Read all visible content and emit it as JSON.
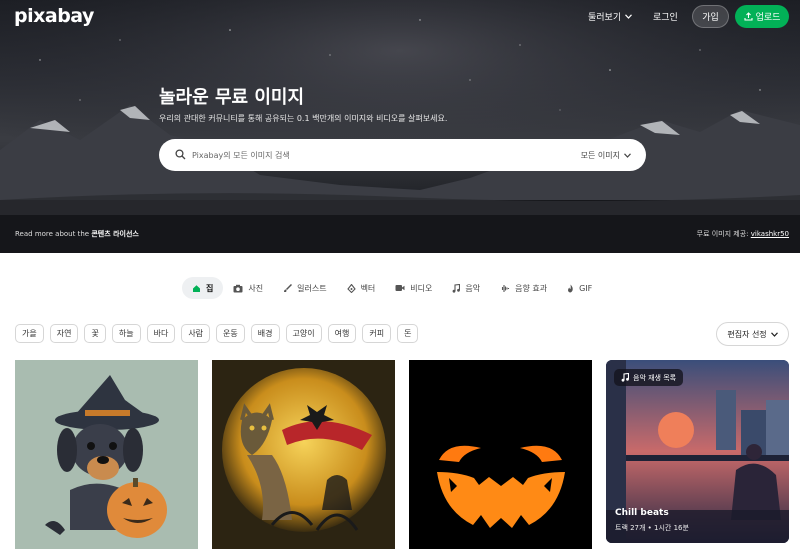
{
  "header": {
    "logo": "pixabay",
    "explore_label": "둘러보기",
    "login_label": "로그인",
    "join_label": "가입",
    "upload_label": "업로드"
  },
  "hero": {
    "title": "놀라운 무료 이미지",
    "subtitle": "우리의 관대한 커뮤니티를 통해 공유되는 0.1 백만개의 이미지와 비디오를 살펴보세요.",
    "search": {
      "placeholder": "Pixabay의 모든 이미지 검색",
      "type_label": "모든 이미지"
    },
    "footer_left_prefix": "Read more about the",
    "footer_left_link": "콘텐츠 라이선스",
    "footer_right_prefix": "무료 이미지 제공:",
    "footer_right_user": "vikashkr50"
  },
  "tabs": [
    {
      "label": "집",
      "icon": "home-icon",
      "active": true
    },
    {
      "label": "사진",
      "icon": "camera-icon",
      "active": false
    },
    {
      "label": "일러스트",
      "icon": "brush-icon",
      "active": false
    },
    {
      "label": "벡터",
      "icon": "vector-icon",
      "active": false
    },
    {
      "label": "비디오",
      "icon": "video-icon",
      "active": false
    },
    {
      "label": "음악",
      "icon": "music-note-icon",
      "active": false
    },
    {
      "label": "음향 효과",
      "icon": "waveform-icon",
      "active": false
    },
    {
      "label": "GIF",
      "icon": "gif-icon",
      "active": false
    }
  ],
  "chips": [
    "가을",
    "자연",
    "꽃",
    "하늘",
    "바다",
    "사람",
    "운동",
    "배경",
    "고양이",
    "여행",
    "커피",
    "돈"
  ],
  "editor_pick_label": "편집자 선정",
  "music_card": {
    "badge": "음악 재생 목록",
    "title": "Chill beats",
    "meta": "트랙 27개 • 1시간 16분"
  },
  "colors": {
    "brand_green": "#02b157",
    "active_tab_bg": "#eef0f2"
  }
}
